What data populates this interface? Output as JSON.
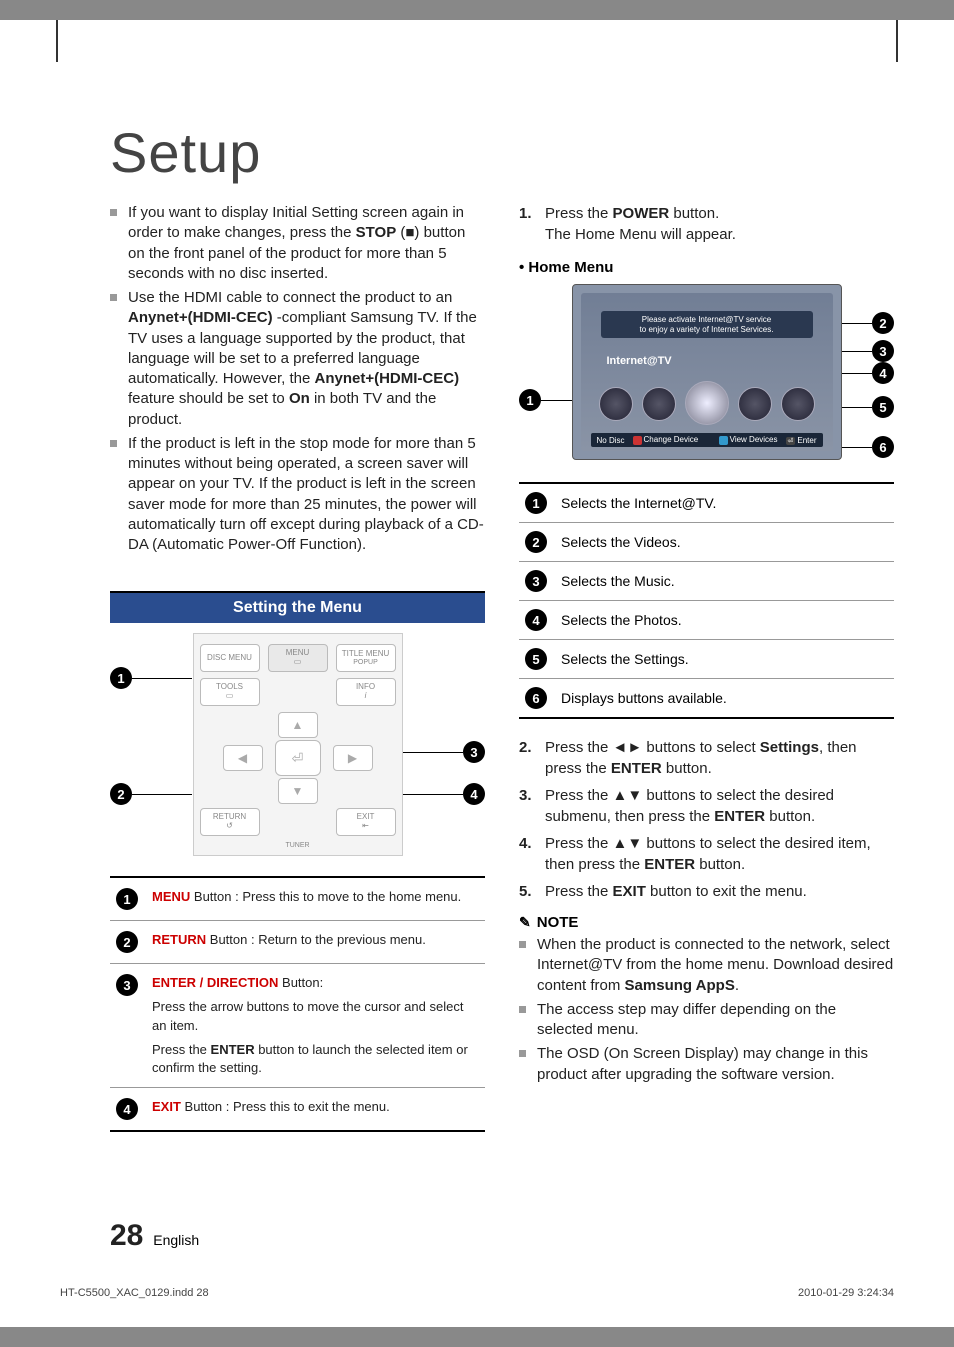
{
  "page_title": "Setup",
  "left_bullets": [
    {
      "pre": "If you want to display Initial Setting screen again in order to make changes, press the ",
      "b1": "STOP",
      "mid": " (■) button on the front panel of the product for more than 5 seconds with no disc inserted."
    },
    {
      "pre": "Use the HDMI cable to connect the product to an ",
      "b1": "Anynet+(HDMI-CEC)",
      "mid": "-compliant Samsung TV. If the TV uses a language supported by the product, that language will be set to a preferred language automatically. However, the ",
      "b2": "Anynet+(HDMI-CEC)",
      "mid2": " feature should be set to ",
      "b3": "On",
      "tail": " in both TV and the product."
    },
    {
      "pre": "If the product is left in the stop mode for more than 5 minutes without being operated, a screen saver will appear on your TV. If the product is left in the screen saver mode for more than 25 minutes, the power will automatically turn off except during playback of a CD-DA (Automatic Power-Off Function)."
    }
  ],
  "setting_menu_title": "Setting the Menu",
  "remote_labels": {
    "disc_menu": "DISC MENU",
    "menu": "MENU",
    "title_menu": "TITLE MENU",
    "popup": "POPUP",
    "tools": "TOOLS",
    "info": "INFO",
    "return": "RETURN",
    "exit": "EXIT",
    "tuner": "TUNER"
  },
  "remote_table": [
    {
      "n": "1",
      "b": "MENU",
      "text": " Button : Press this to move to the home menu."
    },
    {
      "n": "2",
      "b": "RETURN",
      "text": " Button : Return to the previous menu."
    },
    {
      "n": "3",
      "b": "ENTER / DIRECTION",
      "text": " Button:",
      "l1": "Press the arrow buttons to move the cursor and select an item.",
      "l2pre": "Press the ",
      "l2b": "ENTER",
      "l2post": " button to launch the selected item or confirm the setting."
    },
    {
      "n": "4",
      "b": "EXIT",
      "text": " Button : Press this to exit the menu."
    }
  ],
  "steps1": {
    "pre": "Press the ",
    "b": "POWER",
    "post": " button.",
    "l2": "The Home Menu will appear."
  },
  "home_menu_heading": "Home Menu",
  "tv": {
    "banner1": "Please activate Internet@TV service",
    "banner2": "to enjoy a variety of Internet Services.",
    "label": "Internet@TV",
    "bar_nodisc": "No Disc",
    "bar_change": "Change Device",
    "bar_view": "View Devices",
    "bar_enter": "Enter"
  },
  "tv_table": [
    {
      "n": "1",
      "t": "Selects the Internet@TV."
    },
    {
      "n": "2",
      "t": "Selects the Videos."
    },
    {
      "n": "3",
      "t": "Selects the Music."
    },
    {
      "n": "4",
      "t": "Selects the Photos."
    },
    {
      "n": "5",
      "t": "Selects the Settings."
    },
    {
      "n": "6",
      "t": "Displays buttons available."
    }
  ],
  "steps2": [
    {
      "pre": "Press the ◄► buttons to select ",
      "b": "Settings",
      "mid": ", then press the ",
      "b2": "ENTER",
      "post": " button."
    },
    {
      "pre": "Press the ▲▼ buttons to select the desired submenu, then press the ",
      "b": "ENTER",
      "post": " button."
    },
    {
      "pre": "Press the ▲▼ buttons to select the desired item, then press the ",
      "b": "ENTER",
      "post": " button."
    },
    {
      "pre": "Press the ",
      "b": "EXIT",
      "post": " button to exit the menu."
    }
  ],
  "note_label": "NOTE",
  "notes": [
    {
      "pre": "When the product is connected to the network, select Internet@TV from the home menu. Download desired content from ",
      "b": "Samsung AppS",
      "post": "."
    },
    {
      "pre": "The access step may differ depending on the selected menu."
    },
    {
      "pre": "The OSD (On Screen Display) may change in this product after upgrading the software version."
    }
  ],
  "footer_page": "28",
  "footer_lang": "English",
  "meta_file": "HT-C5500_XAC_0129.indd   28",
  "meta_time": "2010-01-29   3:24:34"
}
